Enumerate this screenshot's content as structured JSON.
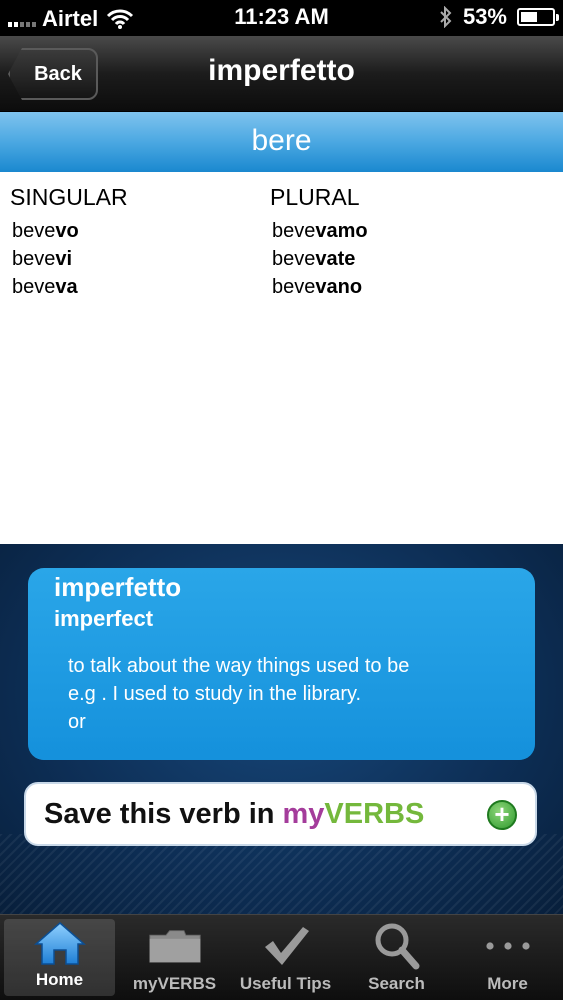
{
  "status_bar": {
    "carrier": "Airtel",
    "time": "11:23 AM",
    "battery": "53%",
    "battery_level": 53
  },
  "nav": {
    "back_label": "Back",
    "title": "imperfetto"
  },
  "verb": "bere",
  "conjugation": {
    "singular_header": "SINGULAR",
    "plural_header": "PLURAL",
    "singular": [
      {
        "stem": "beve",
        "ending": "vo"
      },
      {
        "stem": "beve",
        "ending": "vi"
      },
      {
        "stem": "beve",
        "ending": "va"
      }
    ],
    "plural": [
      {
        "stem": "beve",
        "ending": "vamo"
      },
      {
        "stem": "beve",
        "ending": "vate"
      },
      {
        "stem": "beve",
        "ending": "vano"
      }
    ]
  },
  "info": {
    "title": "imperfetto",
    "subtitle": "imperfect",
    "lines": [
      "to talk about the way things used to be",
      "e.g . I used to study in the library.",
      "or"
    ]
  },
  "save": {
    "text": "Save this verb in",
    "my": "my",
    "verbs": "VERBS"
  },
  "tabs": [
    {
      "label": "Home",
      "icon": "home-icon",
      "active": true
    },
    {
      "label": "myVERBS",
      "icon": "folder-icon",
      "active": false
    },
    {
      "label": "Useful Tips",
      "icon": "checkmark-icon",
      "active": false
    },
    {
      "label": "Search",
      "icon": "search-icon",
      "active": false
    },
    {
      "label": "More",
      "icon": "more-dots-icon",
      "active": false
    }
  ],
  "colors": {
    "accent": "#1a88cf",
    "my_purple": "#a43c9b",
    "verbs_green": "#74b83c"
  }
}
